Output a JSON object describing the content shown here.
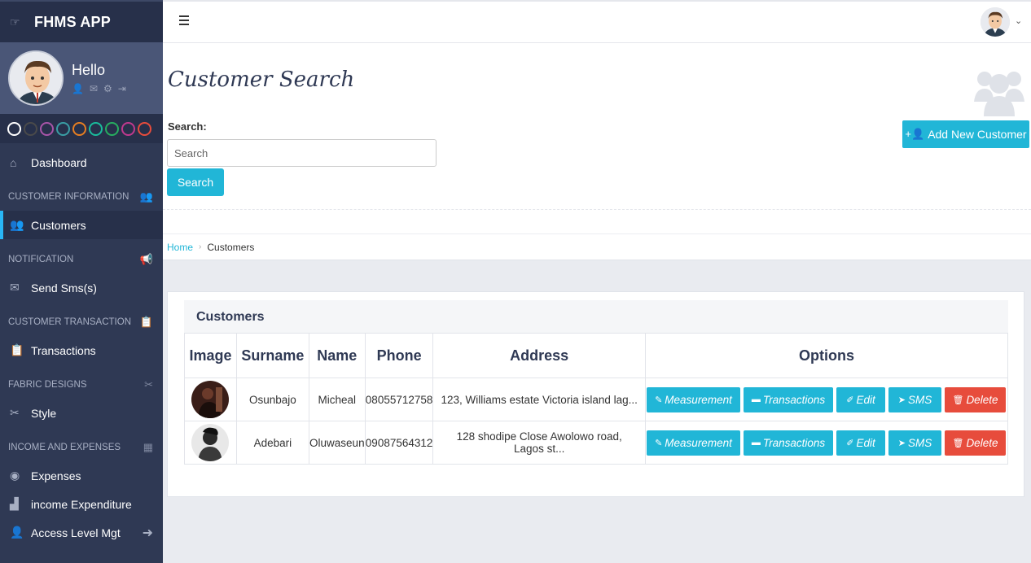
{
  "app": {
    "title": "FHMS APP"
  },
  "profile": {
    "greeting": "Hello"
  },
  "swatch_colors": [
    "#3b3b3b",
    "#4a4a4a",
    "#a855a8",
    "#3a9ea5",
    "#e67e22",
    "#1abc9c",
    "#27ae60",
    "#c0398e",
    "#e74c3c"
  ],
  "sidebar": {
    "dashboard": "Dashboard",
    "sections": {
      "customer_info": "CUSTOMER INFORMATION",
      "notification": "NOTIFICATION",
      "customer_transaction": "CUSTOMER TRANSACTION",
      "fabric_designs": "FABRIC DESIGNS",
      "income_expenses": "INCOME AND EXPENSES"
    },
    "items": {
      "customers": "Customers",
      "send_sms": "Send Sms(s)",
      "transactions": "Transactions",
      "style": "Style",
      "expenses": "Expenses",
      "income_expenditure": "income Expenditure",
      "access_level": "Access Level Mgt"
    }
  },
  "header": {
    "page_title": "Customer Search",
    "add_button": "Add New Customer",
    "search_label": "Search:",
    "search_placeholder": "Search",
    "search_button": "Search"
  },
  "breadcrumb": {
    "home": "Home",
    "current": "Customers"
  },
  "panel": {
    "title": "Customers",
    "columns": [
      "Image",
      "Surname",
      "Name",
      "Phone",
      "Address",
      "Options"
    ],
    "rows": [
      {
        "surname": "Osunbajo",
        "name": "Micheal",
        "phone": "08055712758",
        "address": "123, Williams estate Victoria island lag..."
      },
      {
        "surname": "Adebari",
        "name": "Oluwaseun",
        "phone": "09087564312",
        "address": "128 shodipe Close Awolowo road, Lagos st..."
      }
    ],
    "options": {
      "measurement": "Measurement",
      "transactions": "Transactions",
      "edit": "Edit",
      "sms": "SMS",
      "delete": "Delete"
    }
  }
}
